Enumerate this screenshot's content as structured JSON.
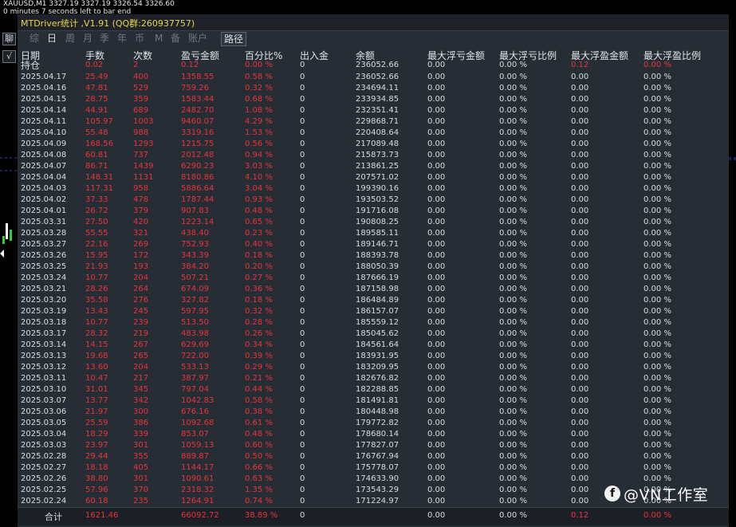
{
  "chart": {
    "symbol_line": "XAUUSD,M1  3327.19 3327.19 3326.54 3326.60",
    "countdown": "0 minutes 7 seconds left to bar end"
  },
  "side": {
    "btn1": "聊",
    "btn2": "√"
  },
  "window": {
    "title": "MTDriver统计 ,V1.91 (QQ群:260937757)"
  },
  "tabs": [
    "综",
    "日",
    "周",
    "月",
    "季",
    "年",
    "币",
    "M",
    "备",
    "账户",
    "路径"
  ],
  "headers": [
    "日期",
    "手数",
    "次数",
    "盈亏金额",
    "百分比%",
    "出入金",
    "余额",
    "最大浮亏金额",
    "最大浮亏比例",
    "最大浮盈金额",
    "最大浮盈比例"
  ],
  "holding": {
    "label": "持仓",
    "lots": "0.02",
    "count": "2",
    "pnl": "0.12",
    "pct": "0.00 %",
    "inout": "0",
    "balance": "236052.66",
    "maxloss": "0.00",
    "maxloss_pct": "0.00 %",
    "maxprofit": "0.12",
    "maxprofit_pct": "0.00 %"
  },
  "rows": [
    [
      "2025.04.17",
      "25.49",
      "400",
      "1358.55",
      "0.58 %",
      "0",
      "236052.66",
      "0.00",
      "0.00 %",
      "0.00",
      "0.00 %"
    ],
    [
      "2025.04.16",
      "47.81",
      "529",
      "759.26",
      "0.32 %",
      "0",
      "234694.11",
      "0.00",
      "0.00 %",
      "0.00",
      "0.00 %"
    ],
    [
      "2025.04.15",
      "28.75",
      "359",
      "1583.44",
      "0.68 %",
      "0",
      "233934.85",
      "0.00",
      "0.00 %",
      "0.00",
      "0.00 %"
    ],
    [
      "2025.04.14",
      "44.91",
      "689",
      "2482.70",
      "1.08 %",
      "0",
      "232351.41",
      "0.00",
      "0.00 %",
      "0.00",
      "0.00 %"
    ],
    [
      "2025.04.11",
      "105.97",
      "1003",
      "9460.07",
      "4.29 %",
      "0",
      "229868.71",
      "0.00",
      "0.00 %",
      "0.00",
      "0.00 %"
    ],
    [
      "2025.04.10",
      "55.48",
      "988",
      "3319.16",
      "1.53 %",
      "0",
      "220408.64",
      "0.00",
      "0.00 %",
      "0.00",
      "0.00 %"
    ],
    [
      "2025.04.09",
      "168.56",
      "1293",
      "1215.75",
      "0.56 %",
      "0",
      "217089.48",
      "0.00",
      "0.00 %",
      "0.00",
      "0.00 %"
    ],
    [
      "2025.04.08",
      "60.81",
      "737",
      "2012.48",
      "0.94 %",
      "0",
      "215873.73",
      "0.00",
      "0.00 %",
      "0.00",
      "0.00 %"
    ],
    [
      "2025.04.07",
      "86.71",
      "1439",
      "6290.23",
      "3.03 %",
      "0",
      "213861.25",
      "0.00",
      "0.00 %",
      "0.00",
      "0.00 %"
    ],
    [
      "2025.04.04",
      "148.31",
      "1131",
      "8180.86",
      "4.10 %",
      "0",
      "207571.02",
      "0.00",
      "0.00 %",
      "0.00",
      "0.00 %"
    ],
    [
      "2025.04.03",
      "117.31",
      "958",
      "5886.64",
      "3.04 %",
      "0",
      "199390.16",
      "0.00",
      "0.00 %",
      "0.00",
      "0.00 %"
    ],
    [
      "2025.04.02",
      "37.33",
      "478",
      "1787.44",
      "0.93 %",
      "0",
      "193503.52",
      "0.00",
      "0.00 %",
      "0.00",
      "0.00 %"
    ],
    [
      "2025.04.01",
      "26.72",
      "379",
      "907.83",
      "0.48 %",
      "0",
      "191716.08",
      "0.00",
      "0.00 %",
      "0.00",
      "0.00 %"
    ],
    [
      "2025.03.31",
      "27.50",
      "420",
      "1223.14",
      "0.65 %",
      "0",
      "190808.25",
      "0.00",
      "0.00 %",
      "0.00",
      "0.00 %"
    ],
    [
      "2025.03.28",
      "55.55",
      "321",
      "438.40",
      "0.23 %",
      "0",
      "189585.11",
      "0.00",
      "0.00 %",
      "0.00",
      "0.00 %"
    ],
    [
      "2025.03.27",
      "22.16",
      "269",
      "752.93",
      "0.40 %",
      "0",
      "189146.71",
      "0.00",
      "0.00 %",
      "0.00",
      "0.00 %"
    ],
    [
      "2025.03.26",
      "15.95",
      "172",
      "343.39",
      "0.18 %",
      "0",
      "188393.78",
      "0.00",
      "0.00 %",
      "0.00",
      "0.00 %"
    ],
    [
      "2025.03.25",
      "21.93",
      "193",
      "384.20",
      "0.20 %",
      "0",
      "188050.39",
      "0.00",
      "0.00 %",
      "0.00",
      "0.00 %"
    ],
    [
      "2025.03.24",
      "10.77",
      "204",
      "507.21",
      "0.27 %",
      "0",
      "187666.19",
      "0.00",
      "0.00 %",
      "0.00",
      "0.00 %"
    ],
    [
      "2025.03.21",
      "28.26",
      "264",
      "674.09",
      "0.36 %",
      "0",
      "187158.98",
      "0.00",
      "0.00 %",
      "0.00",
      "0.00 %"
    ],
    [
      "2025.03.20",
      "35.58",
      "276",
      "327.82",
      "0.18 %",
      "0",
      "186484.89",
      "0.00",
      "0.00 %",
      "0.00",
      "0.00 %"
    ],
    [
      "2025.03.19",
      "13.43",
      "245",
      "597.95",
      "0.32 %",
      "0",
      "186157.07",
      "0.00",
      "0.00 %",
      "0.00",
      "0.00 %"
    ],
    [
      "2025.03.18",
      "10.77",
      "239",
      "513.50",
      "0.28 %",
      "0",
      "185559.12",
      "0.00",
      "0.00 %",
      "0.00",
      "0.00 %"
    ],
    [
      "2025.03.17",
      "28.32",
      "219",
      "483.98",
      "0.26 %",
      "0",
      "185045.62",
      "0.00",
      "0.00 %",
      "0.00",
      "0.00 %"
    ],
    [
      "2025.03.14",
      "14.15",
      "267",
      "629.69",
      "0.34 %",
      "0",
      "184561.64",
      "0.00",
      "0.00 %",
      "0.00",
      "0.00 %"
    ],
    [
      "2025.03.13",
      "19.68",
      "265",
      "722.00",
      "0.39 %",
      "0",
      "183931.95",
      "0.00",
      "0.00 %",
      "0.00",
      "0.00 %"
    ],
    [
      "2025.03.12",
      "13.60",
      "204",
      "533.13",
      "0.29 %",
      "0",
      "183209.95",
      "0.00",
      "0.00 %",
      "0.00",
      "0.00 %"
    ],
    [
      "2025.03.11",
      "10.47",
      "217",
      "387.97",
      "0.21 %",
      "0",
      "182676.82",
      "0.00",
      "0.00 %",
      "0.00",
      "0.00 %"
    ],
    [
      "2025.03.10",
      "31.01",
      "345",
      "797.04",
      "0.44 %",
      "0",
      "182288.85",
      "0.00",
      "0.00 %",
      "0.00",
      "0.00 %"
    ],
    [
      "2025.03.07",
      "13.77",
      "342",
      "1042.83",
      "0.58 %",
      "0",
      "181491.81",
      "0.00",
      "0.00 %",
      "0.00",
      "0.00 %"
    ],
    [
      "2025.03.06",
      "21.97",
      "300",
      "676.16",
      "0.38 %",
      "0",
      "180448.98",
      "0.00",
      "0.00 %",
      "0.00",
      "0.00 %"
    ],
    [
      "2025.03.05",
      "25.59",
      "386",
      "1092.68",
      "0.61 %",
      "0",
      "179772.82",
      "0.00",
      "0.00 %",
      "0.00",
      "0.00 %"
    ],
    [
      "2025.03.04",
      "18.29",
      "339",
      "853.07",
      "0.48 %",
      "0",
      "178680.14",
      "0.00",
      "0.00 %",
      "0.00",
      "0.00 %"
    ],
    [
      "2025.03.03",
      "23.97",
      "301",
      "1059.13",
      "0.60 %",
      "0",
      "177827.07",
      "0.00",
      "0.00 %",
      "0.00",
      "0.00 %"
    ],
    [
      "2025.02.28",
      "29.44",
      "355",
      "889.87",
      "0.50 %",
      "0",
      "176767.94",
      "0.00",
      "0.00 %",
      "0.00",
      "0.00 %"
    ],
    [
      "2025.02.27",
      "18.18",
      "405",
      "1144.17",
      "0.66 %",
      "0",
      "175778.07",
      "0.00",
      "0.00 %",
      "0.00",
      "0.00 %"
    ],
    [
      "2025.02.26",
      "38.80",
      "301",
      "1090.61",
      "0.63 %",
      "0",
      "174633.90",
      "0.00",
      "0.00 %",
      "0.00",
      "0.00 %"
    ],
    [
      "2025.02.25",
      "57.96",
      "370",
      "2318.32",
      "1.35 %",
      "0",
      "173543.29",
      "0.00",
      "0.00 %",
      "0.00",
      "0.00 %"
    ],
    [
      "2025.02.24",
      "60.18",
      "235",
      "1264.91",
      "0.74 %",
      "0",
      "171224.97",
      "0.00",
      "0.00 %",
      "0.00",
      "0.00 %"
    ]
  ],
  "total": {
    "label": "合计",
    "lots": "1621.46",
    "pnl": "66092.72",
    "pct": "38.89 %",
    "inout": "0",
    "maxloss": "0.00",
    "maxloss_pct": "0.00 %",
    "maxprofit": "0.12",
    "maxprofit_pct": "0.00 %"
  },
  "watermark": {
    "text": "@VN工作室",
    "logo_glyph": "f"
  },
  "colors": {
    "positive": "#e8333b",
    "title": "#e7d64a",
    "panel": "#272d34"
  }
}
